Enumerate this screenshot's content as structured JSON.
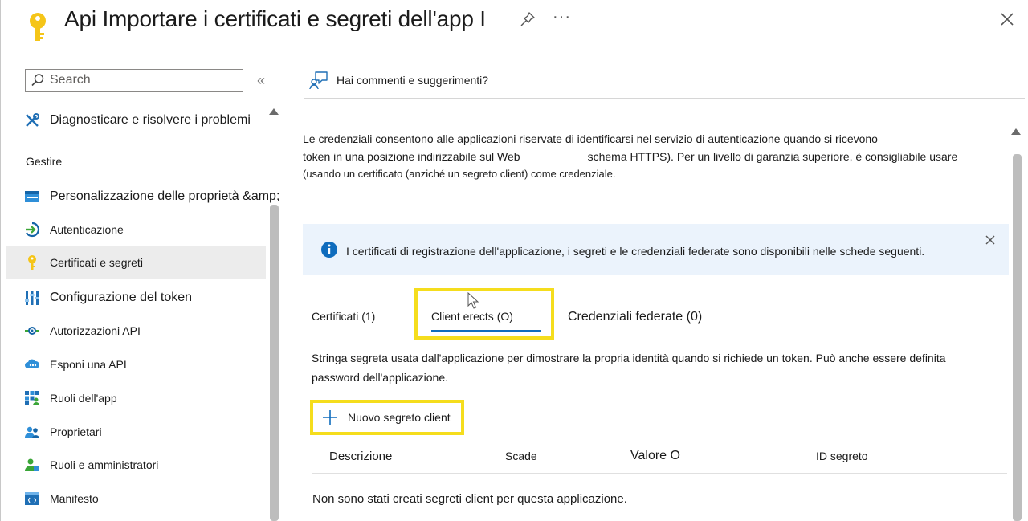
{
  "header": {
    "title": "Api Importare i certificati e segreti dell'app I",
    "more_label": "···"
  },
  "sidebar": {
    "search_placeholder": "Search",
    "collapse_label": "«",
    "diagnose": "Diagnosticare e risolvere i problemi",
    "section_title": "Gestire",
    "items": [
      {
        "label": "Personalizzazione delle proprietà &amp;",
        "icon": "branding-icon"
      },
      {
        "label": "Autenticazione",
        "icon": "authentication-icon"
      },
      {
        "label": "Certificati e segreti",
        "icon": "key-icon"
      },
      {
        "label": "Configurazione del token",
        "icon": "token-config-icon"
      },
      {
        "label": "Autorizzazioni API",
        "icon": "api-permissions-icon"
      },
      {
        "label": "Esponi una API",
        "icon": "cloud-icon"
      },
      {
        "label": "Ruoli dell'app",
        "icon": "app-roles-icon"
      },
      {
        "label": "Proprietari",
        "icon": "owners-icon"
      },
      {
        "label": "Ruoli e amministratori",
        "icon": "roles-admin-icon"
      },
      {
        "label": "Manifesto",
        "icon": "manifest-icon"
      }
    ]
  },
  "main": {
    "feedback_label": "Hai commenti e suggerimenti?",
    "intro": {
      "line1": "Le credenziali consentono alle applicazioni riservate di identificarsi nel servizio di autenticazione quando si ricevono",
      "line2a": "token in una posizione indirizzabile sul Web",
      "line2b": "schema HTTPS). Per un livello di garanzia superiore, è consigliabile usare",
      "line3": "(usando un certificato (anziché un segreto client) come credenziale."
    },
    "info_text": "I certificati di registrazione dell'applicazione, i segreti e le credenziali federate sono disponibili nelle schede seguenti.",
    "tabs": [
      {
        "label": "Certificati (1)"
      },
      {
        "label": "Client erects (O)"
      },
      {
        "label": "Credenziali federate (0)"
      }
    ],
    "description_line1": "Stringa segreta usata dall'applicazione per dimostrare la propria identità quando si richiede un token. Può anche essere definita",
    "description_line2": "password dell'applicazione.",
    "new_secret_label": "Nuovo segreto client",
    "table": {
      "headers": [
        "Descrizione",
        "Scade",
        "Valore O",
        "ID segreto"
      ],
      "empty_message": "Non sono stati creati segreti client per questa applicazione."
    }
  },
  "colors": {
    "highlight": "#f5dd1d",
    "accent": "#0f6cbd",
    "info_background": "#ebf3fc",
    "active_item": "#ececec"
  }
}
